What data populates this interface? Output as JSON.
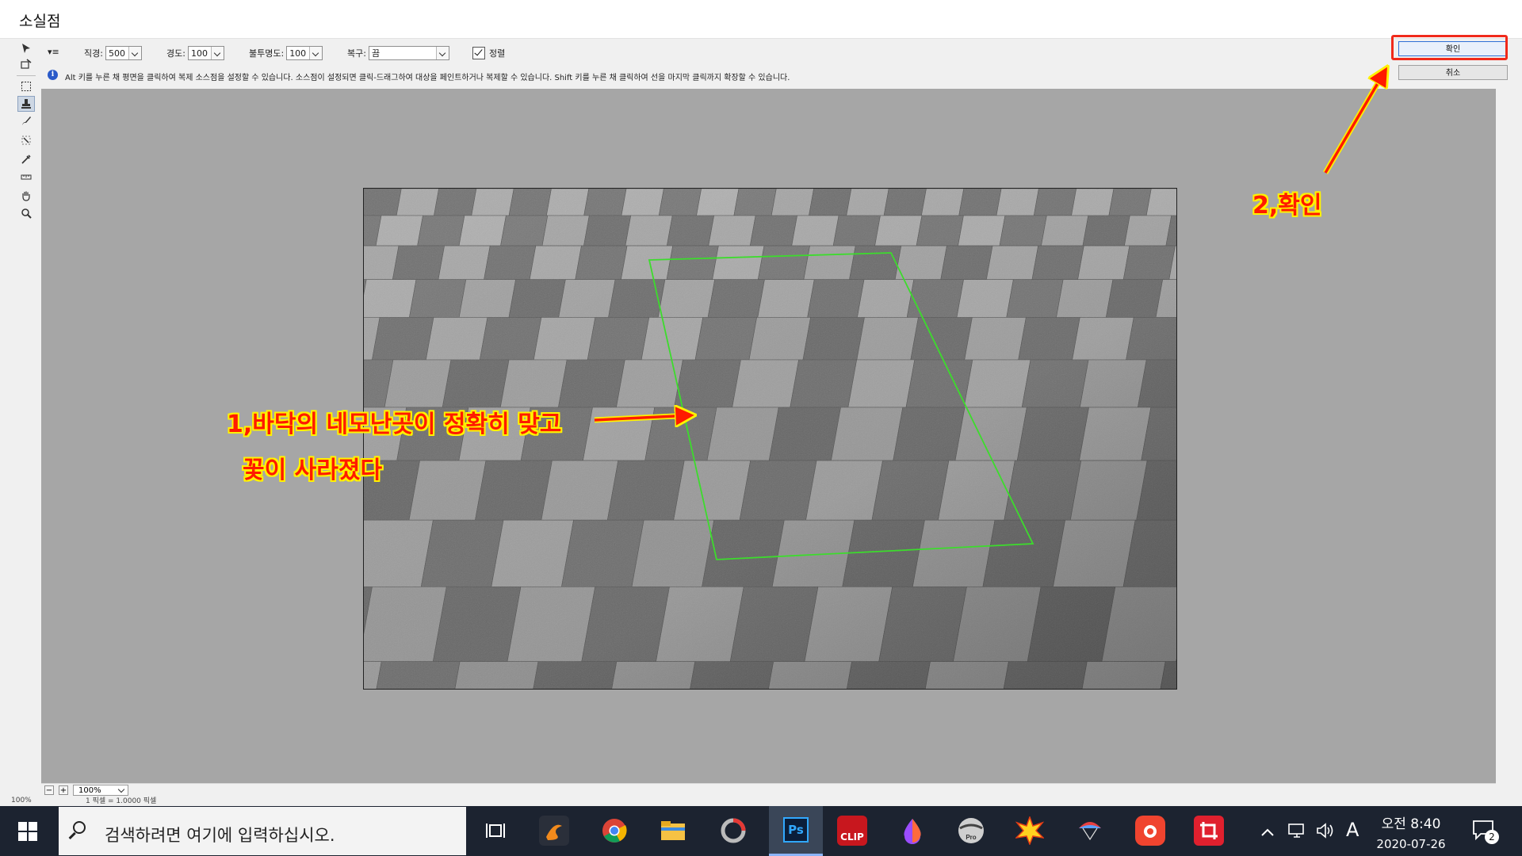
{
  "window": {
    "title": "소실점"
  },
  "options": {
    "menu_icon": "▾≡",
    "size_label": "직경:",
    "size_value": "500",
    "hardness_label": "경도:",
    "hardness_value": "100",
    "opacity_label": "불투명도:",
    "opacity_value": "100",
    "heal_label": "복구:",
    "heal_value": "끔",
    "align_label": "정렬",
    "align_checked": true
  },
  "info": {
    "text": "Alt 키를 누른 채 평면을 클릭하여 복제 소스점을 설정할 수 있습니다. 소스점이 설정되면 클릭-드래그하여 대상을 페인트하거나 복제할 수 있습니다. Shift 키를 누른 채 클릭하여 선을 마지막 클릭까지 확장할 수 있습니다."
  },
  "buttons": {
    "ok": "확인",
    "cancel": "취소"
  },
  "status": {
    "zoom": "100%",
    "below_left": "100%",
    "below_mid": "1 픽셀 = 1.0000 픽셀"
  },
  "annotations": {
    "note1_line1": "1,바닥의 네모난곳이 정확히 맞고",
    "note1_line2": "꽃이 사라졌다",
    "note2": "2,확인"
  },
  "taskbar": {
    "search_placeholder": "검색하려면 여기에 입력하십시오.",
    "apps": [
      "task-view-icon",
      "sketch-app-icon",
      "chrome-icon",
      "file-explorer-icon",
      "photoscape-icon",
      "photoshop-icon",
      "clip-icon",
      "paint-drop-icon",
      "pro-app-icon",
      "burst-app-icon",
      "parachute-app-icon",
      "camera-app-icon",
      "crop-pro-icon"
    ],
    "ps_label": "Ps",
    "clip_label": "CLIP",
    "ime": "A",
    "time": "오전 8:40",
    "date": "2020-07-26",
    "notifications": "2"
  },
  "colors": {
    "annotation": "#ff1a00",
    "annotation_outline": "#fff200",
    "highlight": "#f02a1b",
    "plane_grid": "#3cdc2c"
  }
}
